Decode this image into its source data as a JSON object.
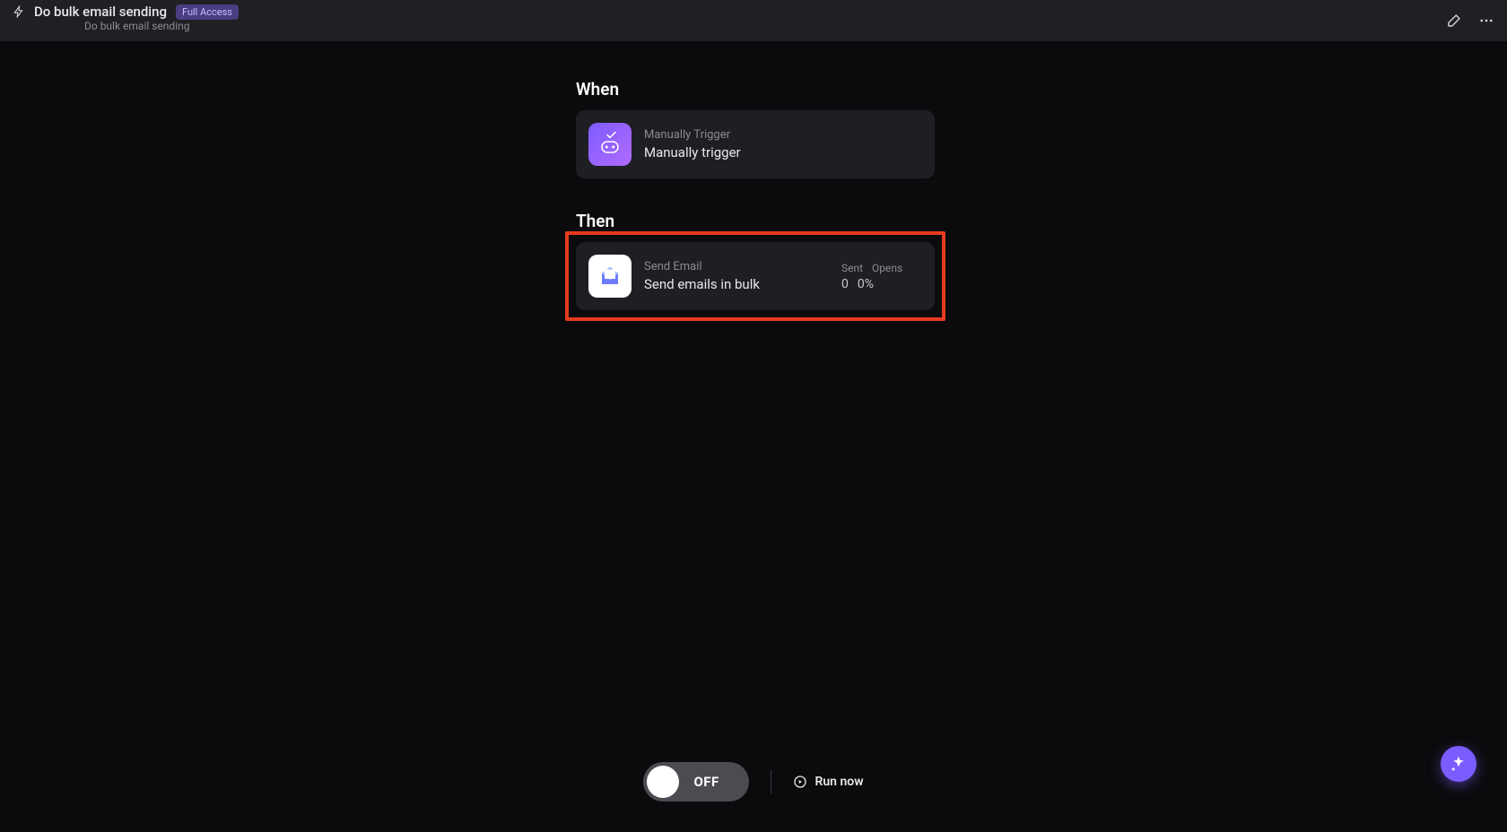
{
  "header": {
    "title": "Do bulk email sending",
    "subtitle": "Do bulk email sending",
    "badge": "Full Access"
  },
  "sections": {
    "when": {
      "label": "When",
      "card": {
        "type_label": "Manually Trigger",
        "title": "Manually trigger"
      }
    },
    "then": {
      "label": "Then",
      "card": {
        "type_label": "Send Email",
        "title": "Send emails in bulk",
        "stats_header_sent": "Sent",
        "stats_header_opens": "Opens",
        "stats_sent": "0",
        "stats_opens": "0%"
      }
    }
  },
  "bottom": {
    "toggle_state": "OFF",
    "run_label": "Run now"
  }
}
